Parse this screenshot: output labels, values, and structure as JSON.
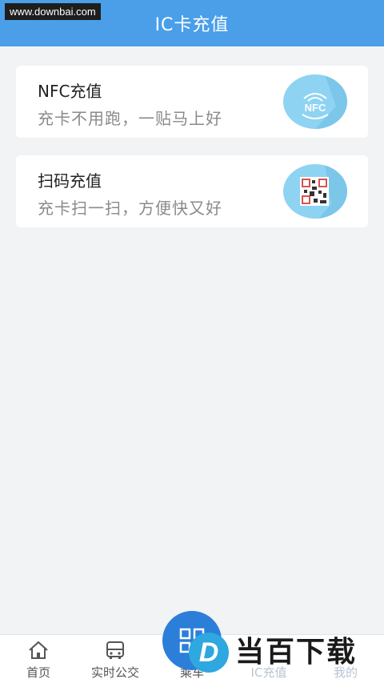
{
  "header": {
    "title": "IC卡充值"
  },
  "watermark": "www.downbai.com",
  "cards": [
    {
      "title": "NFC充值",
      "subtitle": "充卡不用跑，一贴马上好",
      "icon": "nfc-icon",
      "icon_text": "NFC"
    },
    {
      "title": "扫码充值",
      "subtitle": "充卡扫一扫，方便快又好",
      "icon": "qr-code-icon"
    }
  ],
  "tabbar": {
    "tabs": [
      {
        "label": "首页",
        "icon": "home-icon"
      },
      {
        "label": "实时公交",
        "icon": "bus-icon"
      },
      {
        "label": "乘车",
        "icon": "qr-code-icon"
      },
      {
        "label": "IC充值",
        "icon": "card-icon"
      },
      {
        "label": "我的",
        "icon": "user-icon"
      }
    ]
  },
  "logo_overlay": {
    "mark": "D",
    "text": "当百下载"
  },
  "colors": {
    "header_bg": "#4a9fe8",
    "background": "#f2f3f5",
    "icon_circle": "#8ed3f2",
    "fab": "#2c7fd8"
  }
}
